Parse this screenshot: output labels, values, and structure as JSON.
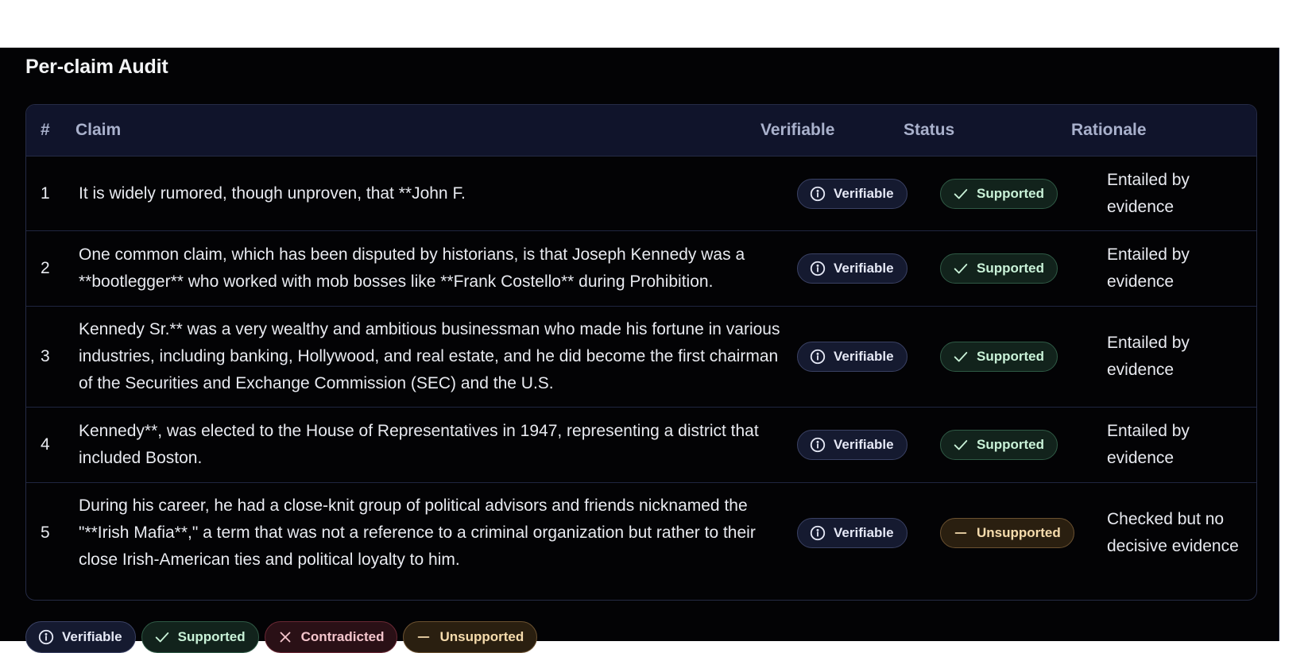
{
  "section": {
    "title": "Per-claim Audit"
  },
  "table": {
    "headers": {
      "num": "#",
      "claim": "Claim",
      "verifiable": "Verifiable",
      "status": "Status",
      "rationale": "Rationale"
    },
    "rows": [
      {
        "num": "1",
        "claim": "It is widely rumored, though unproven, that **John F.",
        "verifiable": "Verifiable",
        "status": "Supported",
        "status_kind": "supported",
        "rationale": "Entailed by evidence"
      },
      {
        "num": "2",
        "claim": "One common claim, which has been disputed by historians, is that Joseph Kennedy was a **bootlegger** who worked with mob bosses like **Frank Costello** during Prohibition.",
        "verifiable": "Verifiable",
        "status": "Supported",
        "status_kind": "supported",
        "rationale": "Entailed by evidence"
      },
      {
        "num": "3",
        "claim": "Kennedy Sr.** was a very wealthy and ambitious businessman who made his fortune in various industries, including banking, Hollywood, and real estate, and he did become the first chairman of the Securities and Exchange Commission (SEC) and the U.S.",
        "verifiable": "Verifiable",
        "status": "Supported",
        "status_kind": "supported",
        "rationale": "Entailed by evidence"
      },
      {
        "num": "4",
        "claim": "Kennedy**, was elected to the House of Representatives in 1947, representing a district that included Boston.",
        "verifiable": "Verifiable",
        "status": "Supported",
        "status_kind": "supported",
        "rationale": "Entailed by evidence"
      },
      {
        "num": "5",
        "claim": "During his career, he had a close-knit group of political advisors and friends nicknamed the \"**Irish Mafia**,\" a term that was not a reference to a criminal organization but rather to their close Irish-American ties and political loyalty to him.",
        "verifiable": "Verifiable",
        "status": "Unsupported",
        "status_kind": "unsupported",
        "rationale": "Checked but no decisive evidence"
      }
    ]
  },
  "legend": {
    "verifiable": "Verifiable",
    "supported": "Supported",
    "contradicted": "Contradicted",
    "unsupported": "Unsupported"
  },
  "icons": {
    "verifiable": "info-circle-icon",
    "supported": "check-icon",
    "contradicted": "x-icon",
    "unsupported": "minus-icon"
  },
  "colors": {
    "supported": "#c9f2d8",
    "unsupported": "#f6dcad",
    "contradicted": "#f4c5cc",
    "verifiable": "#e5e8f5"
  }
}
